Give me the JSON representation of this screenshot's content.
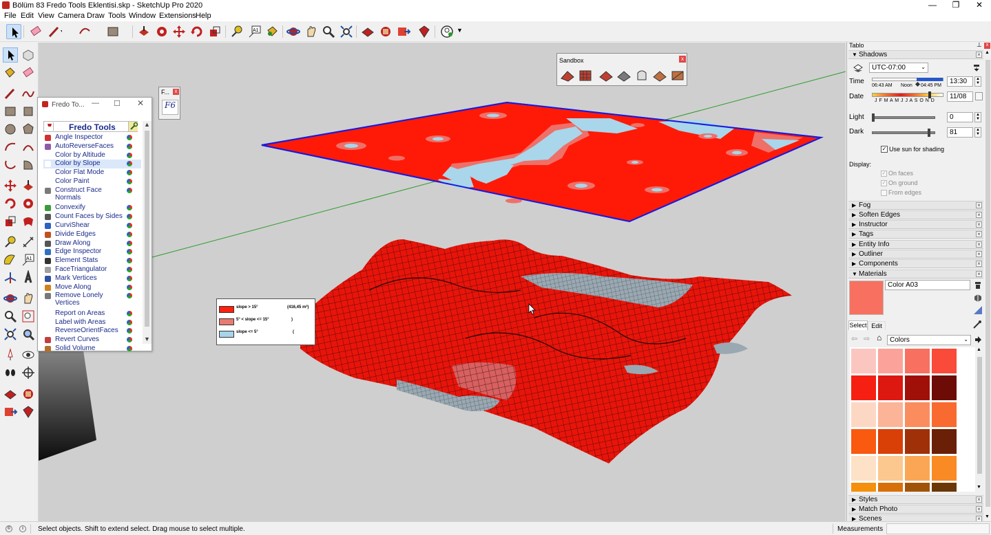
{
  "window": {
    "title": "Bölüm 83 Fredo Tools Eklentisi.skp - SketchUp Pro 2020",
    "minimize": "—",
    "maximize": "❐",
    "close": "✕"
  },
  "menu": [
    "File",
    "Edit",
    "View",
    "Camera",
    "Draw",
    "Tools",
    "Window",
    "Extensions",
    "Help"
  ],
  "fredo": {
    "title": "Fredo To...",
    "banner": "Fredo Tools",
    "mini_title": "F...",
    "mini_glyph": "F6",
    "items": [
      {
        "label": "Angle Inspector",
        "icon": "angle-icon",
        "color": "#d32f2f"
      },
      {
        "label": "AutoReverseFaces",
        "icon": "reverse-faces-icon",
        "color": "#8e5aa8"
      },
      {
        "label": "Color by Altitude",
        "icon": "altitude-icon",
        "color": "#ffffff"
      },
      {
        "label": "Color by Slope",
        "icon": "slope-icon",
        "color": "#ffffff"
      },
      {
        "label": "Color Flat Mode",
        "icon": "flat-mode-icon",
        "color": "#ffffff"
      },
      {
        "label": "Color Paint",
        "icon": "paint-icon",
        "color": "#ffffff"
      },
      {
        "label": "Construct Face Normals",
        "icon": "face-normals-icon",
        "color": "#7a7a7a"
      },
      {
        "label": "Convexify",
        "icon": "convexify-icon",
        "color": "#3b9b3b"
      },
      {
        "label": "Count Faces by Sides",
        "icon": "count-faces-icon",
        "color": "#555555"
      },
      {
        "label": "CurviShear",
        "icon": "curvishear-icon",
        "color": "#3060c0"
      },
      {
        "label": "Divide Edges",
        "icon": "divide-edges-icon",
        "color": "#c05020"
      },
      {
        "label": "Draw Along",
        "icon": "draw-along-icon",
        "color": "#555555"
      },
      {
        "label": "Edge Inspector",
        "icon": "edge-inspector-icon",
        "color": "#3070c0"
      },
      {
        "label": "Element Stats",
        "icon": "element-stats-icon",
        "color": "#333333"
      },
      {
        "label": "FaceTriangulator",
        "icon": "triangulator-icon",
        "color": "#a0a0a0"
      },
      {
        "label": "Mark Vertices",
        "icon": "mark-vertices-icon",
        "color": "#3050a0"
      },
      {
        "label": "Move Along",
        "icon": "move-along-icon",
        "color": "#d08020"
      },
      {
        "label": "Remove Lonely Vertices",
        "icon": "remove-vertices-icon",
        "color": "#777777"
      },
      {
        "label": "Report on Areas",
        "icon": "report-areas-icon",
        "color": "#ffffff"
      },
      {
        "label": "Label with Areas",
        "icon": "label-areas-icon",
        "color": "#ffffff"
      },
      {
        "label": "ReverseOrientFaces",
        "icon": "reverse-orient-icon",
        "color": "#ffffff"
      },
      {
        "label": "Revert Curves",
        "icon": "revert-curves-icon",
        "color": "#c04040"
      },
      {
        "label": "Solid Volume",
        "icon": "solid-volume-icon",
        "color": "#b07030"
      }
    ],
    "selected_index": 3
  },
  "sandbox": {
    "title": "Sandbox"
  },
  "legend": {
    "rows": [
      {
        "swatch": "#ff2010",
        "text": "slope > 15°",
        "value": "(416,45 m²)"
      },
      {
        "swatch": "#e87a74",
        "text": "5° < slope <= 15°",
        "value": ")"
      },
      {
        "swatch": "#a8d4ea",
        "text": "slope <= 5°",
        "value": "("
      }
    ]
  },
  "tray": {
    "title": "Tablo",
    "shadows": {
      "header": "Shadows",
      "timezone": "UTC-07:00",
      "time_label": "Time",
      "time_sunrise": "06:43 AM",
      "time_noon": "Noon",
      "time_sunset": "04:45 PM",
      "time_value": "13:30",
      "date_label": "Date",
      "months": "J F M A M J J A S O N D",
      "date_value": "11/08",
      "light_label": "Light",
      "light_value": "0",
      "dark_label": "Dark",
      "dark_value": "81",
      "use_sun": "Use sun for shading",
      "display_label": "Display:",
      "on_faces": "On faces",
      "on_ground": "On ground",
      "from_edges": "From edges"
    },
    "collapsed": [
      "Fog",
      "Soften Edges",
      "Instructor",
      "Tags",
      "Entity Info",
      "Outliner",
      "Components"
    ],
    "materials": {
      "header": "Materials",
      "name": "Color A03",
      "current_color": "#f87060",
      "tab_select": "Select",
      "tab_edit": "Edit",
      "library": "Colors",
      "swatches": [
        "#fcc6c0",
        "#fba39a",
        "#f87060",
        "#f94a3a",
        "#f52012",
        "#dd1810",
        "#a01008",
        "#6d0c06",
        "#fcd8c4",
        "#fcb498",
        "#fa8c5e",
        "#f96a30",
        "#f95a10",
        "#d84008",
        "#a03008",
        "#6a2006",
        "#fde2c8",
        "#fcc890",
        "#fba654",
        "#f98a24",
        "#f5900c",
        "#d8700a",
        "#a05408",
        "#6a3806"
      ]
    },
    "bottom": [
      "Styles",
      "Match Photo",
      "Scenes"
    ]
  },
  "status": {
    "text": "Select objects. Shift to extend select. Drag mouse to select multiple.",
    "measurements_label": "Measurements"
  }
}
